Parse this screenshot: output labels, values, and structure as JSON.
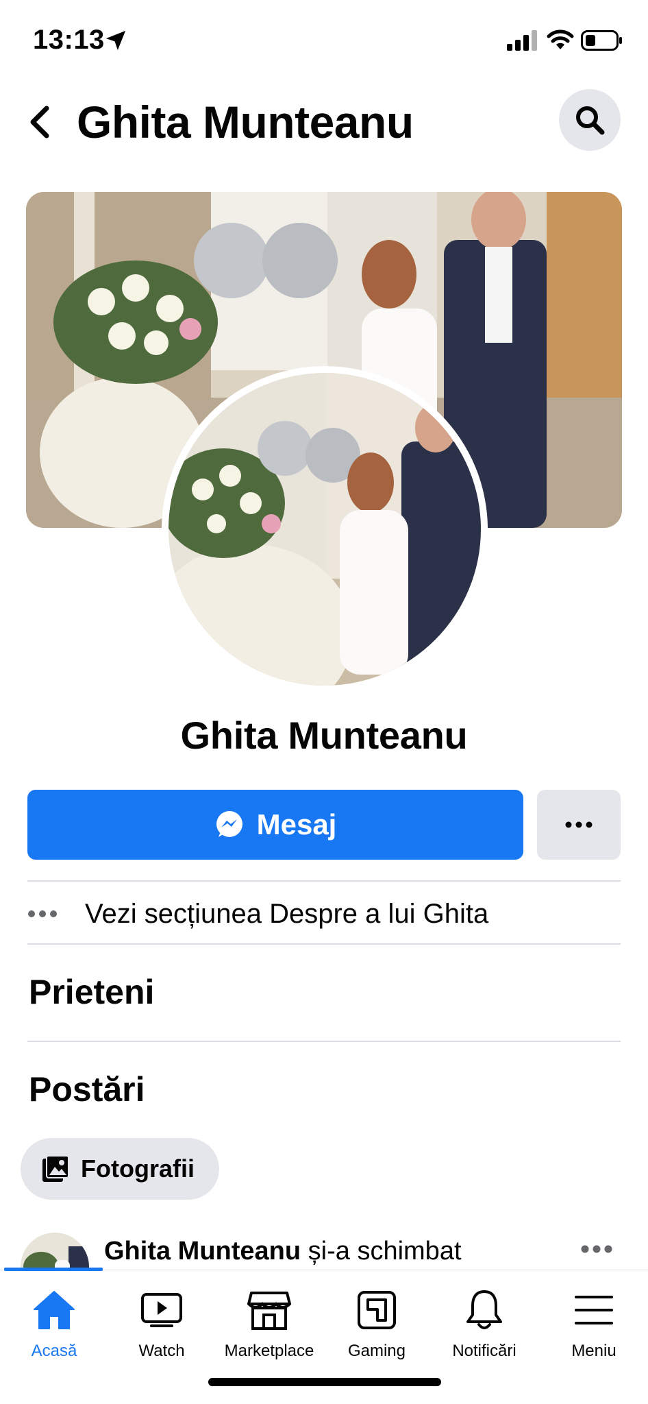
{
  "status_bar": {
    "time": "13:13"
  },
  "header": {
    "title": "Ghita Munteanu"
  },
  "profile": {
    "name": "Ghita Munteanu",
    "message_button": "Mesaj",
    "about_link": "Vezi secțiunea Despre a lui Ghita"
  },
  "sections": {
    "friends": "Prieteni",
    "posts": "Postări",
    "photos_chip": "Fotografii"
  },
  "post_preview": {
    "author": "Ghita Munteanu",
    "action": " și-a schimbat"
  },
  "bottom_nav": [
    {
      "label": "Acasă",
      "icon": "home-icon",
      "active": true
    },
    {
      "label": "Watch",
      "icon": "watch-icon",
      "active": false
    },
    {
      "label": "Marketplace",
      "icon": "marketplace-icon",
      "active": false
    },
    {
      "label": "Gaming",
      "icon": "gaming-icon",
      "active": false
    },
    {
      "label": "Notificări",
      "icon": "bell-icon",
      "active": false
    },
    {
      "label": "Meniu",
      "icon": "menu-icon",
      "active": false
    }
  ],
  "colors": {
    "accent": "#1877f2",
    "chip_bg": "#e4e6eb",
    "divider": "#dadde1"
  }
}
